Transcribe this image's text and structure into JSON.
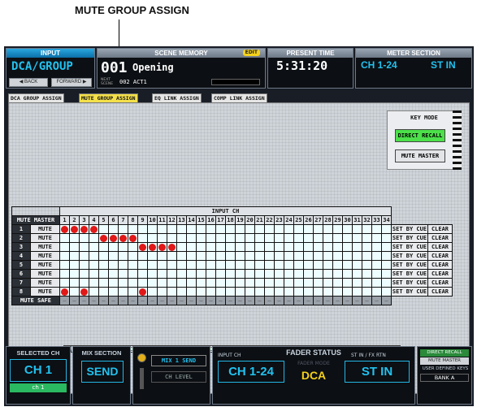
{
  "callout": "MUTE GROUP ASSIGN",
  "header": {
    "input_label": "INPUT",
    "function": "DCA/GROUP",
    "back": "◀ BACK",
    "forward": "FORWARD ▶",
    "scene_memory_label": "SCENE MEMORY",
    "edit_badge": "EDIT",
    "scene_number": "001",
    "scene_name": "Opening",
    "next_scene_label": "NEXT SCENE",
    "next_scene": "002 ACT1",
    "present_time_label": "PRESENT TIME",
    "time": "5:31:20",
    "meter_label": "METER SECTION",
    "meter_ch": "CH 1-24",
    "meter_st": "ST IN"
  },
  "tabs": [
    "DCA GROUP ASSIGN",
    "MUTE GROUP ASSIGN",
    "EQ LINK ASSIGN",
    "COMP LINK ASSIGN"
  ],
  "key_mode": {
    "title": "KEY MODE",
    "direct_recall": "DIRECT RECALL",
    "mute_master": "MUTE MASTER"
  },
  "grid": {
    "mute_master_label": "MUTE MASTER",
    "input_ch_label": "INPUT CH",
    "mute_label": "MUTE",
    "mute_safe_label": "MUTE SAFE",
    "set_by_cue": "SET BY CUE",
    "clear": "CLEAR",
    "channels": [
      "1",
      "2",
      "3",
      "4",
      "5",
      "6",
      "7",
      "8",
      "9",
      "10",
      "11",
      "12",
      "13",
      "14",
      "15",
      "16",
      "17",
      "18",
      "19",
      "20",
      "21",
      "22",
      "23",
      "24",
      "25",
      "26",
      "27",
      "28",
      "29",
      "30",
      "31",
      "32",
      "33",
      "34"
    ],
    "rows": [
      {
        "group": "1",
        "assigned": [
          1,
          2,
          3,
          4
        ]
      },
      {
        "group": "2",
        "assigned": [
          5,
          6,
          7,
          8
        ]
      },
      {
        "group": "3",
        "assigned": [
          9,
          10,
          11,
          12
        ]
      },
      {
        "group": "4",
        "assigned": []
      },
      {
        "group": "5",
        "assigned": []
      },
      {
        "group": "6",
        "assigned": []
      },
      {
        "group": "7",
        "assigned": []
      },
      {
        "group": "8",
        "assigned": [
          1,
          3,
          9
        ]
      }
    ]
  },
  "footer": {
    "selected_ch_label": "SELECTED CH",
    "selected_ch": "CH 1",
    "selected_ch_name": "ch 1",
    "mix_section_label": "MIX SECTION",
    "mix_section_value": "SEND",
    "mix_send": "MIX 1 SEND",
    "ch_level": "CH LEVEL",
    "fader_status_label": "FADER STATUS",
    "input_ch_label": "INPUT CH",
    "fader_ch": "CH 1-24",
    "fader_mode_label": "FADER MODE",
    "fader_mode": "DCA",
    "st_in_fx_label": "ST IN / FX RTN",
    "st_in": "ST IN",
    "direct_recall": "DIRECT RECALL",
    "mute_master": "MUTE MASTER",
    "user_defined_keys": "USER DEFINED KEYS",
    "bank": "BANK A"
  }
}
